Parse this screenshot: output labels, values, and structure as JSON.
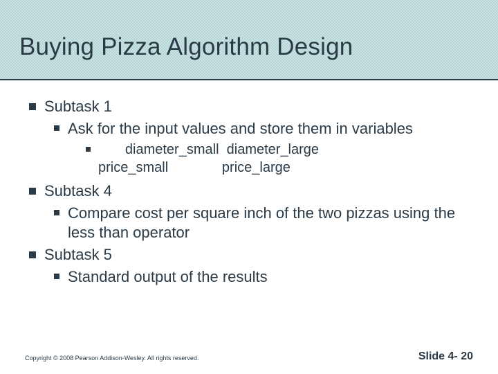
{
  "title": "Buying Pizza Algorithm Design",
  "bullets": {
    "subtask1": {
      "heading": "Subtask 1",
      "point": "Ask for the input values and store them in variables",
      "vars_line1": "diameter_small  diameter_large",
      "vars_line2": "price_small              price_large"
    },
    "subtask4": {
      "heading": "Subtask 4",
      "point": "Compare cost per square inch of the two pizzas using the less than operator"
    },
    "subtask5": {
      "heading": "Subtask 5",
      "point": "Standard output of the results"
    }
  },
  "footer": {
    "copyright": "Copyright © 2008 Pearson Addison-Wesley.  All rights reserved.",
    "slide_label": "Slide 4- 20"
  }
}
